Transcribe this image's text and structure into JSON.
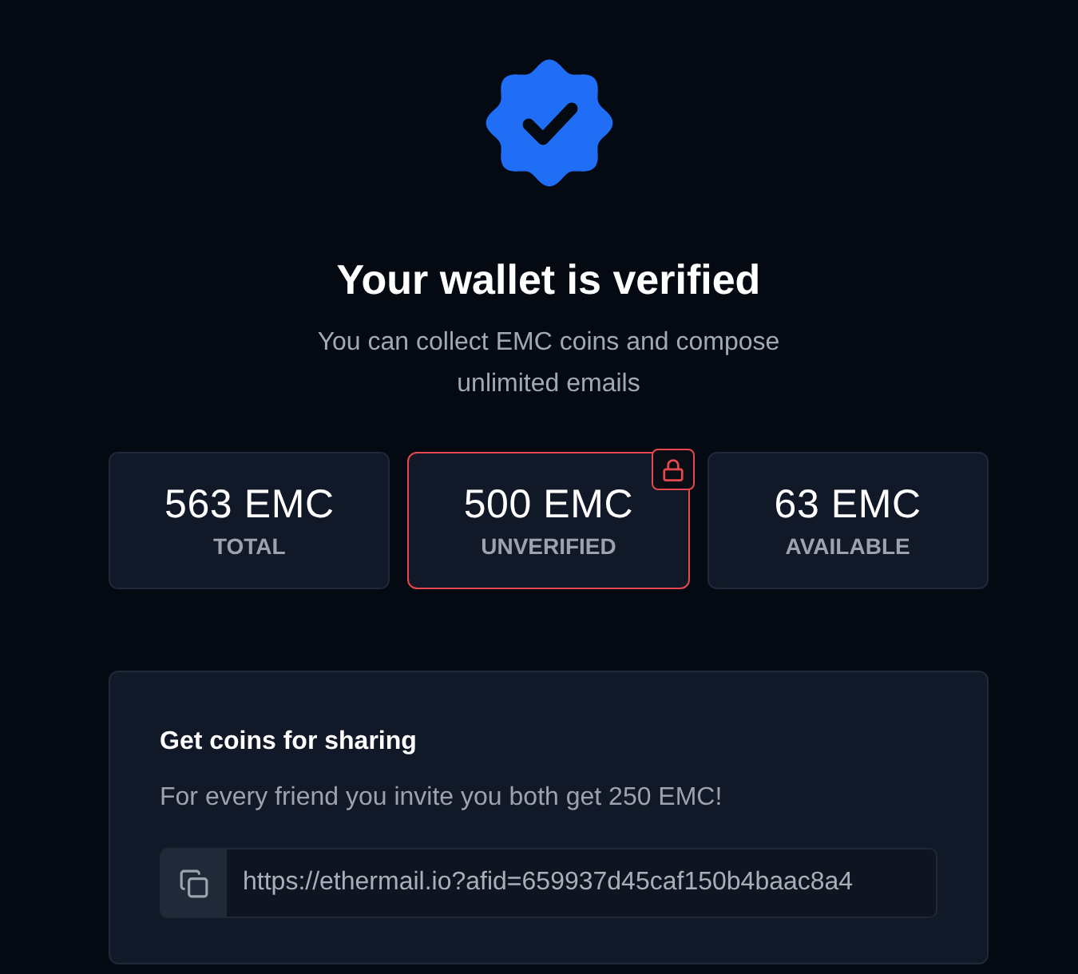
{
  "header": {
    "title": "Your wallet is verified",
    "subtitle": "You can collect EMC coins and compose unlimited emails"
  },
  "stats": [
    {
      "amount": "563 EMC",
      "label": "TOTAL",
      "locked": false
    },
    {
      "amount": "500 EMC",
      "label": "UNVERIFIED",
      "locked": true
    },
    {
      "amount": "63 EMC",
      "label": "AVAILABLE",
      "locked": false
    }
  ],
  "share": {
    "title": "Get coins for sharing",
    "description": "For every friend you invite you both get 250 EMC!",
    "link": "https://ethermail.io?afid=659937d45caf150b4baac8a4"
  }
}
